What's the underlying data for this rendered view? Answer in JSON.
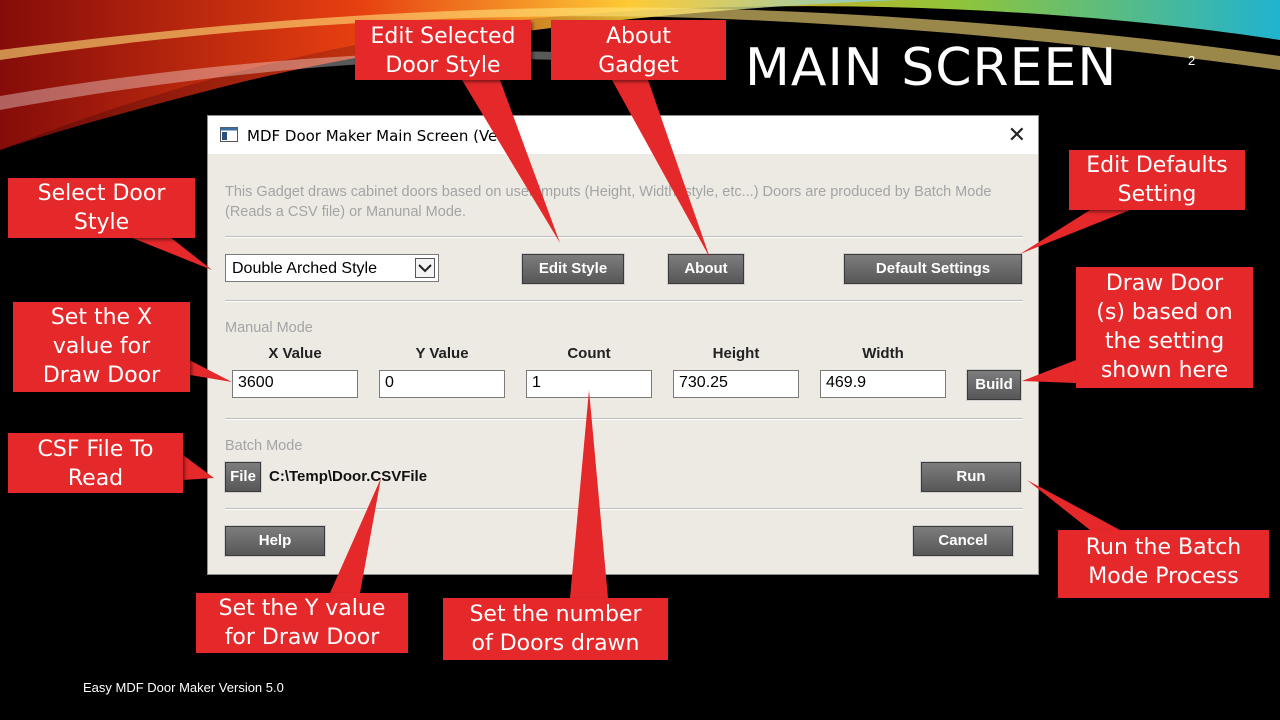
{
  "slide": {
    "title": "MAIN SCREEN",
    "number": "2",
    "footer": "Easy MDF Door Maker Version 5.0"
  },
  "dialog": {
    "title": "MDF Door Maker Main Screen (Ver.",
    "close_icon": "close-icon",
    "description": "This Gadget draws cabinet doors based on user imputs (Height, Width, style, etc...) Doors are produced by Batch Mode (Reads a CSV file) or Manunal Mode.",
    "style_select": {
      "value": "Double Arched Style"
    },
    "edit_style_label": "Edit Style",
    "about_label": "About",
    "default_settings_label": "Default Settings",
    "manual_mode_label": "Manual Mode",
    "columns": [
      {
        "label": "X Value",
        "value": "3600"
      },
      {
        "label": "Y Value",
        "value": "0"
      },
      {
        "label": "Count",
        "value": "1"
      },
      {
        "label": "Height",
        "value": "730.25"
      },
      {
        "label": "Width",
        "value": "469.9"
      }
    ],
    "build_label": "Build",
    "batch_mode_label": "Batch Mode",
    "file_label": "File",
    "file_path": "C:\\Temp\\Door.CSVFile",
    "run_label": "Run",
    "help_label": "Help",
    "cancel_label": "Cancel"
  },
  "callouts": {
    "edit_selected": [
      "Edit Selected",
      "Door Style"
    ],
    "about_gadget": [
      "About",
      "Gadget"
    ],
    "edit_defaults": [
      "Edit Defaults",
      "Setting"
    ],
    "select_style": [
      "Select Door",
      "Style"
    ],
    "set_x": [
      "Set the X",
      "value for",
      "Draw Door"
    ],
    "draw_door": [
      "Draw Door",
      "(s) based on",
      "the setting",
      "shown here"
    ],
    "csf_file": [
      "CSF File To",
      "Read"
    ],
    "run_batch": [
      "Run the Batch",
      "Mode Process"
    ],
    "set_y": [
      "Set the Y value",
      "for Draw Door"
    ],
    "set_count": [
      "Set the number",
      "of Doors drawn"
    ]
  },
  "colors": {
    "callout": "#e5282a",
    "dialog_bg": "#eceae3",
    "button_dark": "#5f5f5f"
  }
}
